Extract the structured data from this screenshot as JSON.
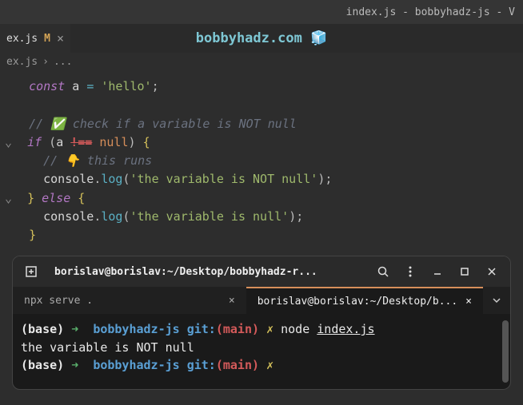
{
  "window": {
    "title": "index.js - bobbyhadz-js - V"
  },
  "watermark": "bobbyhadz.com 🧊",
  "tab": {
    "name": "ex.js",
    "modified_marker": "M",
    "close": "×"
  },
  "breadcrumb": {
    "file": "ex.js",
    "sep": "›",
    "rest": "..."
  },
  "code": {
    "l1": {
      "kw": "const",
      "var": "a",
      "op": "=",
      "str": "'hello'",
      "semi": ";"
    },
    "l2": {
      "comment": "// ✅ check if a variable is NOT null"
    },
    "l3": {
      "kw": "if",
      "lp": "(",
      "var": "a",
      "op": "!==",
      "null": "null",
      "rp": ")",
      "lb": "{"
    },
    "l4": {
      "comment": "// 👇 this runs"
    },
    "l5": {
      "obj": "console",
      "dot": ".",
      "fn": "log",
      "lp": "(",
      "str": "'the variable is NOT null'",
      "rp": ")",
      "semi": ";"
    },
    "l6": {
      "rb": "}",
      "kw": "else",
      "lb": "{"
    },
    "l7": {
      "obj": "console",
      "dot": ".",
      "fn": "log",
      "lp": "(",
      "str": "'the variable is null'",
      "rp": ")",
      "semi": ";"
    },
    "l8": {
      "rb": "}"
    }
  },
  "terminal": {
    "header_title": "borislav@borislav:~/Desktop/bobbyhadz-r...",
    "tabs": {
      "t1": {
        "label": "npx serve .",
        "close": "×"
      },
      "t2": {
        "label": "borislav@borislav:~/Desktop/b...",
        "close": "×"
      }
    },
    "lines": {
      "l1": {
        "base": "(base)",
        "arrow": "➜",
        "dir": "bobbyhadz-js",
        "git": "git:",
        "lp": "(",
        "branch": "main",
        "rp": ")",
        "x": "✗",
        "cmd": "node",
        "file": "index.js"
      },
      "l2": {
        "out": "the variable is NOT null"
      },
      "l3": {
        "base": "(base)",
        "arrow": "➜",
        "dir": "bobbyhadz-js",
        "git": "git:",
        "lp": "(",
        "branch": "main",
        "rp": ")",
        "x": "✗"
      }
    }
  }
}
